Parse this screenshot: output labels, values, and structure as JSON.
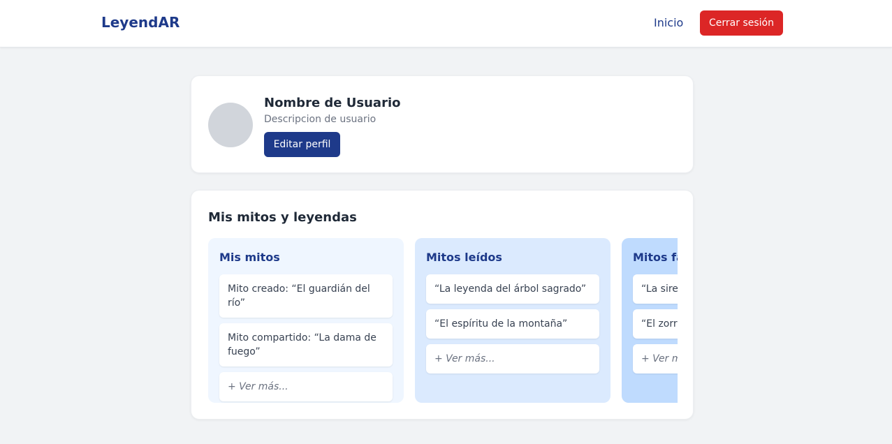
{
  "header": {
    "brand": "LeyendAR",
    "nav_home": "Inicio",
    "logout_label": "Cerrar sesión"
  },
  "profile": {
    "name": "Nombre de Usuario",
    "description": "Descripcion de usuario",
    "edit_label": "Editar perfil"
  },
  "myths": {
    "title": "Mis mitos y leyendas",
    "columns": [
      {
        "title": "Mis mitos",
        "items": [
          "Mito creado: “El guardián del río”",
          "Mito compartido: “La dama de fuego”"
        ],
        "more": "+ Ver más..."
      },
      {
        "title": "Mitos leídos",
        "items": [
          "“La leyenda del árbol sagrado”",
          "“El espíritu de la montaña”"
        ],
        "more": "+ Ver más..."
      },
      {
        "title": "Mitos fa",
        "items": [
          "“La siren",
          "“El zorro"
        ],
        "more": "+ Ver mo"
      }
    ]
  },
  "colors": {
    "brand": "#1e3a8a",
    "logout": "#dc2626",
    "col_bg": [
      "#eff6ff",
      "#dbeafe",
      "#bfdbfe"
    ]
  }
}
